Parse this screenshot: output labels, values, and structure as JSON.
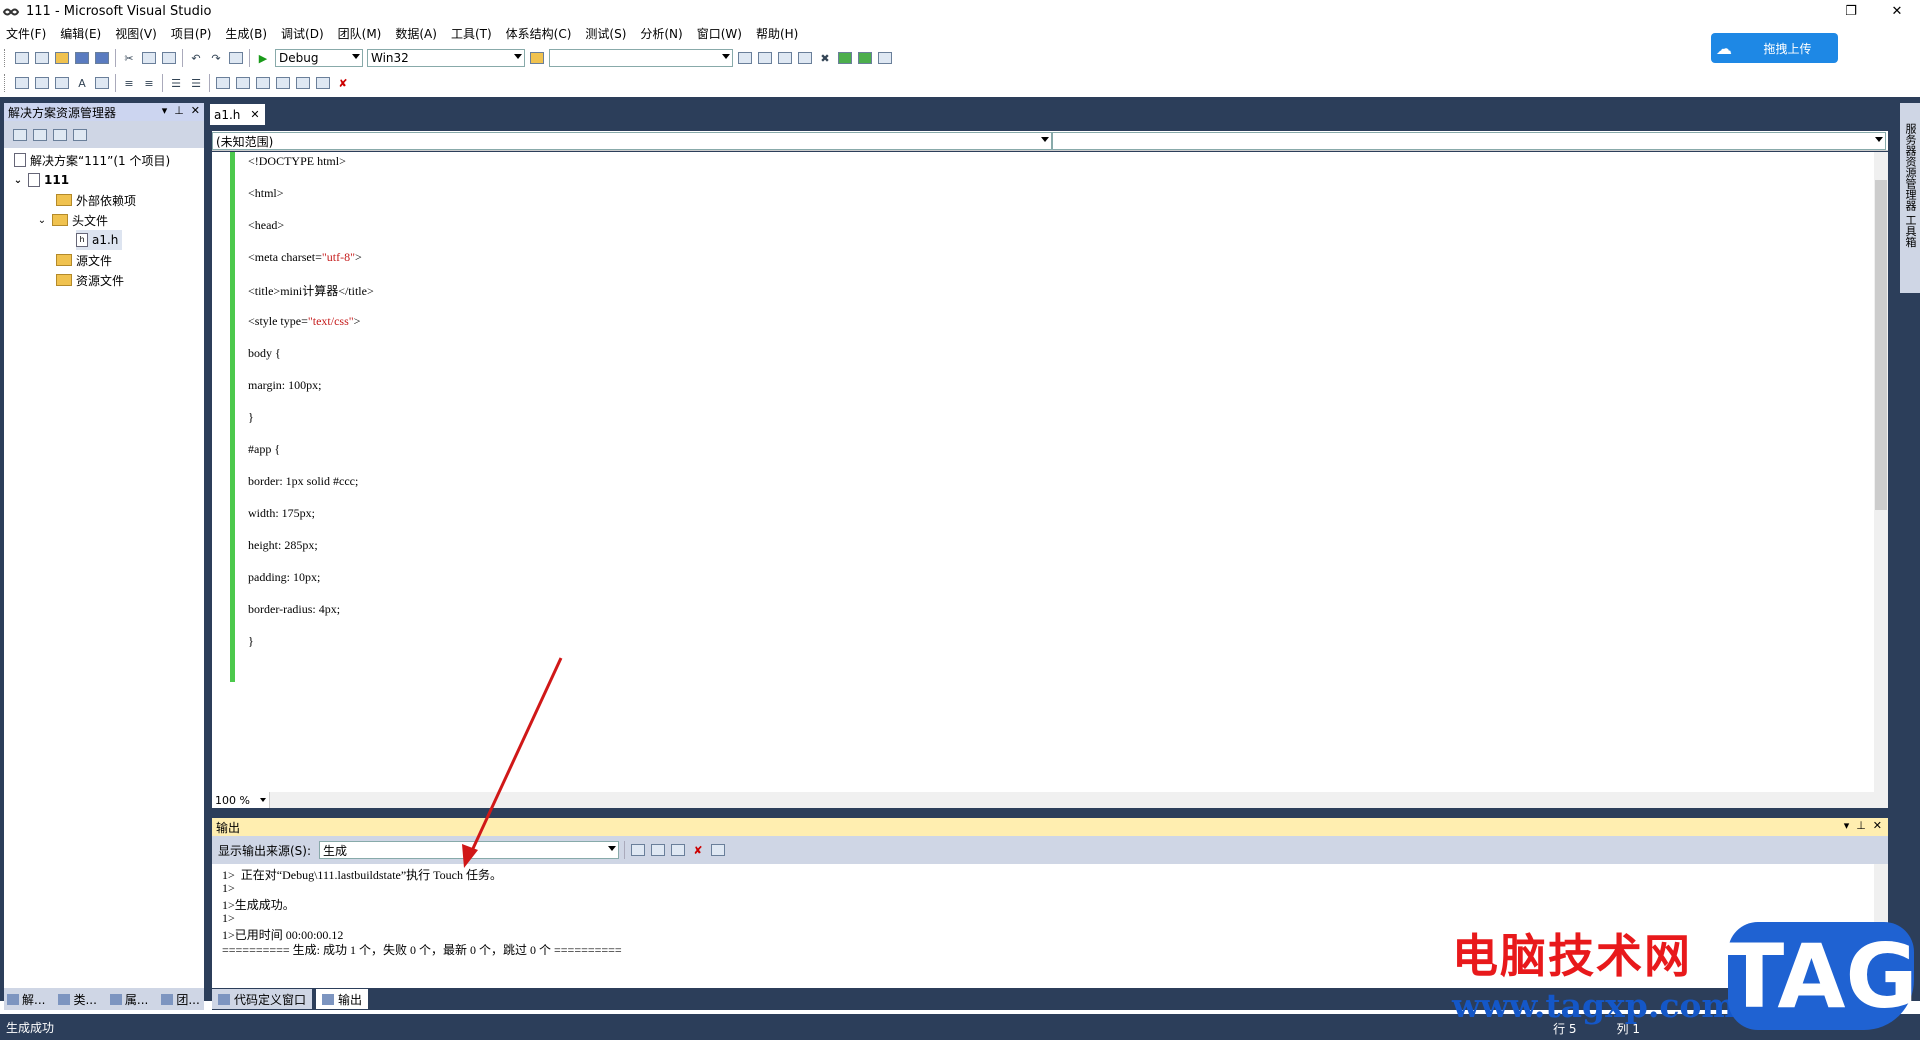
{
  "window": {
    "title": "111 - Microsoft Visual Studio",
    "restore_icon": "restore-icon",
    "close_icon": "close-icon"
  },
  "menu": [
    "文件(F)",
    "编辑(E)",
    "视图(V)",
    "项目(P)",
    "生成(B)",
    "调试(D)",
    "团队(M)",
    "数据(A)",
    "工具(T)",
    "体系结构(C)",
    "测试(S)",
    "分析(N)",
    "窗口(W)",
    "帮助(H)"
  ],
  "toolbar": {
    "config": "Debug",
    "platform": "Win32",
    "search": ""
  },
  "upload_button": "拖拽上传",
  "solution_explorer": {
    "title": "解决方案资源管理器",
    "nodes": {
      "solution": "解决方案“111”(1 个项目)",
      "project": "111",
      "external": "外部依赖项",
      "headers": "头文件",
      "file": "a1.h",
      "sources": "源文件",
      "resources": "资源文件"
    }
  },
  "left_tabs": [
    "解...",
    "类...",
    "属...",
    "团..."
  ],
  "editor": {
    "tab": "a1.h",
    "scope": "(未知范围)",
    "zoom": "100 %",
    "lines": [
      {
        "t": "<!DOCTYPE html>"
      },
      {
        "t": "<html>"
      },
      {
        "t": "<head>"
      },
      {
        "t": "<meta charset=",
        "s": "\"utf-8\"",
        "e": ">"
      },
      {
        "t": "<title>mini计算器</title>"
      },
      {
        "t": "<style type=",
        "s": "\"text/css\"",
        "e": ">"
      },
      {
        "t": "body {"
      },
      {
        "t": "margin: 100px;"
      },
      {
        "t": "}"
      },
      {
        "t": "#app {"
      },
      {
        "t": "border: 1px solid #ccc;"
      },
      {
        "t": "width: 175px;"
      },
      {
        "t": "height: 285px;"
      },
      {
        "t": "padding: 10px;"
      },
      {
        "t": "border-radius: 4px;"
      },
      {
        "t": "}"
      }
    ]
  },
  "output": {
    "title": "输出",
    "source_label": "显示输出来源(S):",
    "source_value": "生成",
    "lines": [
      "1>  正在对“Debug\\111.lastbuildstate”执行 Touch 任务。",
      "1>",
      "1>生成成功。",
      "1>",
      "1>已用时间 00:00:00.12",
      "========== 生成: 成功 1 个，失败 0 个，最新 0 个，跳过 0 个 =========="
    ]
  },
  "bottom_tabs": [
    "代码定义窗口",
    "输出"
  ],
  "status": {
    "text": "生成成功",
    "row": "行 5",
    "col": "列 1"
  },
  "right_panel": "服务器资源管理器   工具箱",
  "watermark": {
    "text": "电脑技术网",
    "url": "www.tagxp.com",
    "logo": "TAG"
  },
  "colors": {
    "frame": "#2c3e5a",
    "gutter": "#4cc94c",
    "string": "#c51a1a",
    "watermark_red": "#e8191b",
    "watermark_blue": "#1f62d2"
  }
}
